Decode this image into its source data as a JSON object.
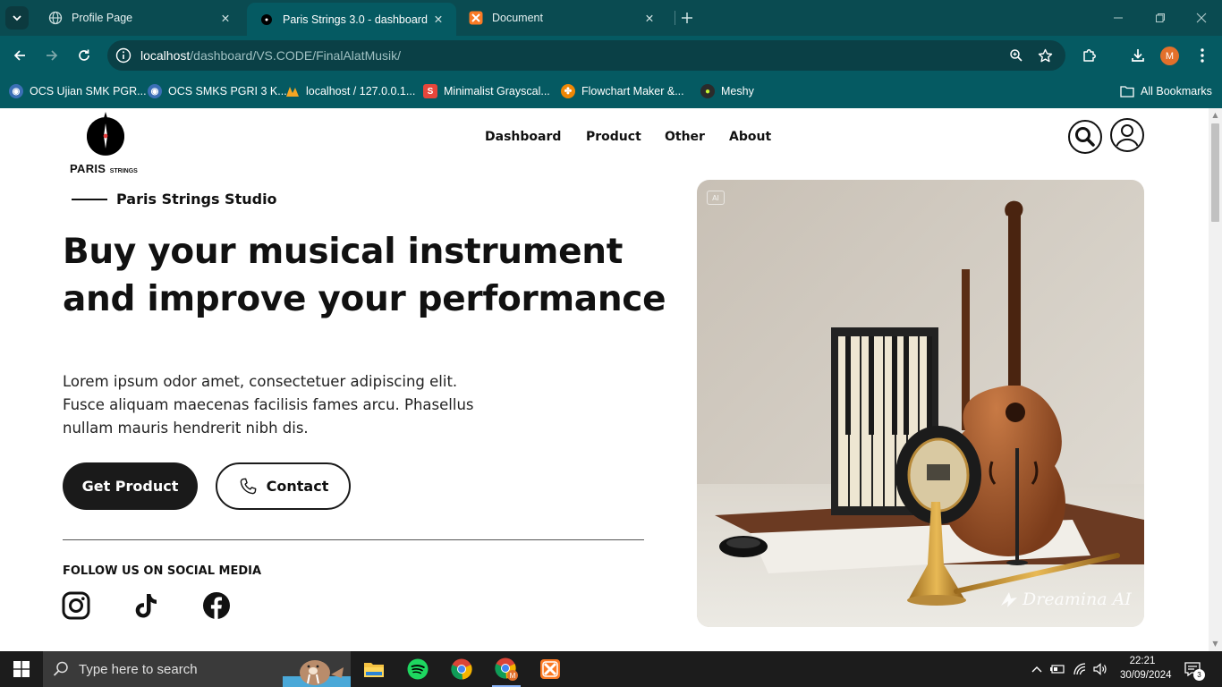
{
  "browser": {
    "tabs": [
      {
        "title": "Profile Page",
        "active": false
      },
      {
        "title": "Paris Strings 3.0 - dashboard",
        "active": true
      },
      {
        "title": "Document",
        "active": false
      }
    ],
    "url_host": "localhost",
    "url_path": "/dashboard/VS.CODE/FinalAlatMusik/",
    "profile_initial": "M",
    "bookmarks": [
      {
        "label": "OCS Ujian SMK PGR..."
      },
      {
        "label": "OCS SMKS PGRI 3 K..."
      },
      {
        "label": "localhost / 127.0.0.1..."
      },
      {
        "label": "Minimalist Grayscal..."
      },
      {
        "label": "Flowchart Maker &..."
      },
      {
        "label": "Meshy"
      }
    ],
    "all_bookmarks": "All Bookmarks"
  },
  "site": {
    "logo_main": "PARIS",
    "logo_sub": "STRINGS",
    "nav": [
      "Dashboard",
      "Product",
      "Other",
      "About"
    ],
    "eyebrow": "Paris Strings Studio",
    "hero_title_lines": [
      "Buy your musical instrument",
      "and improve your performance"
    ],
    "hero_desc_lines": [
      "Lorem ipsum odor amet, consectetuer adipiscing elit.",
      "Fusce aliquam maecenas facilisis fames arcu. Phasellus",
      "nullam mauris hendrerit nibh dis."
    ],
    "cta_primary": "Get Product",
    "cta_secondary": "Contact",
    "follow_label": "FOLLOW US ON SOCIAL MEDIA",
    "social": [
      "instagram-icon",
      "tiktok-icon",
      "facebook-icon"
    ],
    "image_badge": "AI",
    "image_watermark": "Dreamina AI"
  },
  "taskbar": {
    "search_placeholder": "Type here to search",
    "time": "22:21",
    "date": "30/09/2024",
    "notification_count": "3"
  },
  "colors": {
    "browser_frame": "#055a62",
    "tab_strip": "#0a4b51",
    "text_dark": "#111111",
    "button_dark": "#1a1a1a"
  }
}
